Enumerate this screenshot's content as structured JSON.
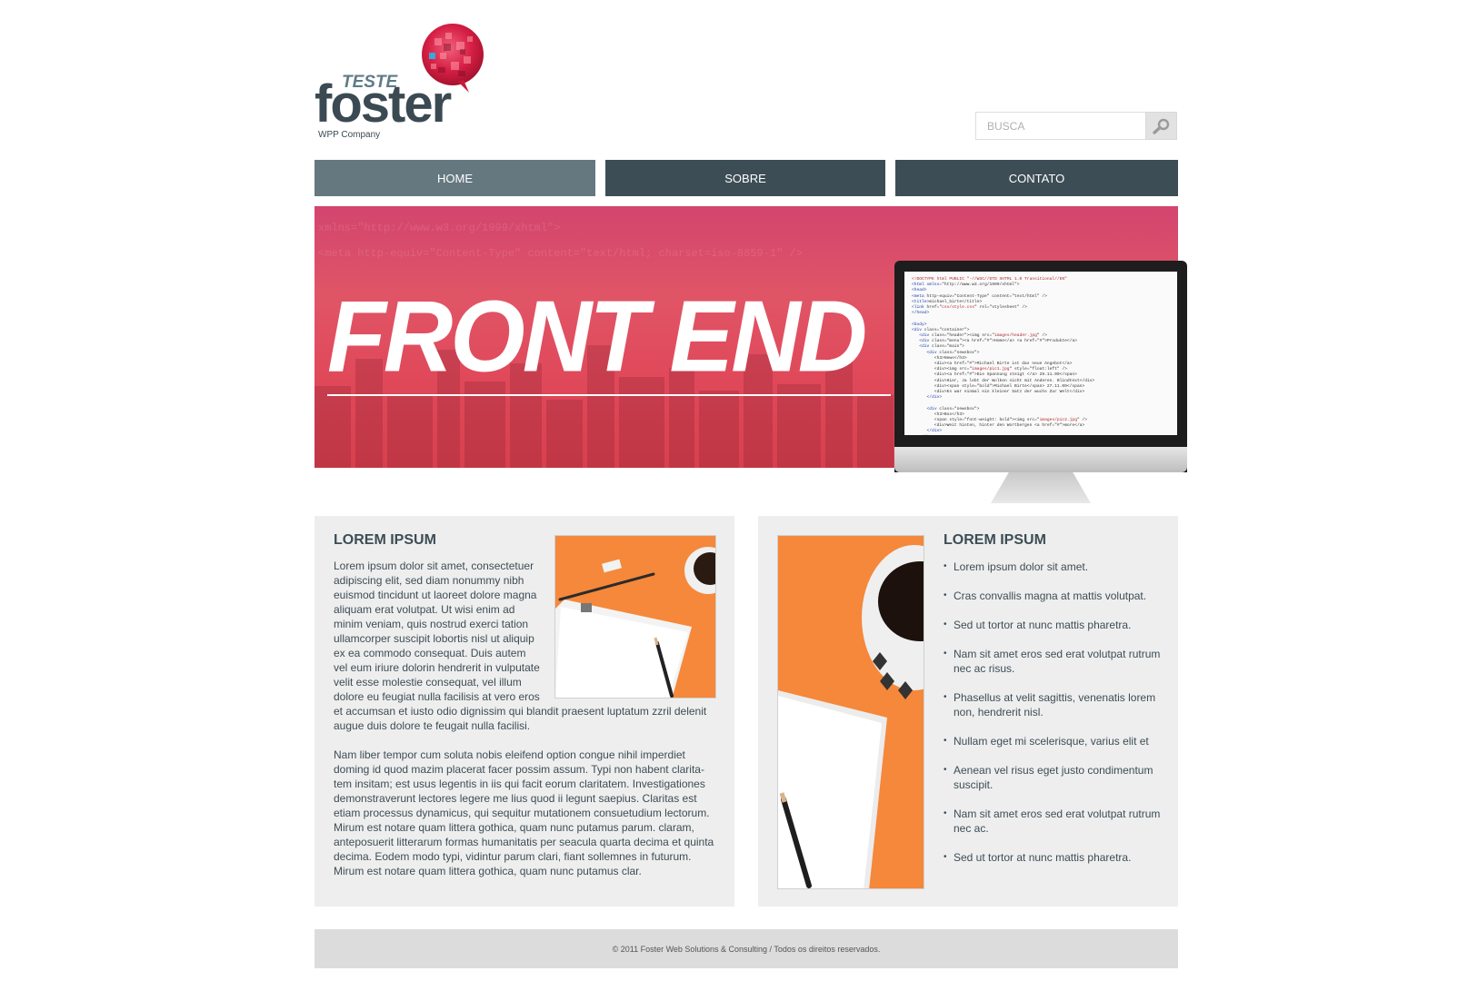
{
  "logo": {
    "teste": "TESTE",
    "name": "foster",
    "tagline": "WPP Company"
  },
  "search": {
    "placeholder": "BUSCA",
    "icon": "search-icon"
  },
  "nav": {
    "items": [
      {
        "label": "HOME"
      },
      {
        "label": "SOBRE"
      },
      {
        "label": "CONTATO"
      }
    ]
  },
  "banner": {
    "title": "FRONT END",
    "code_bg": "xmlns=\"http://www.w3.org/1999/xhtml\">\n<meta http-equiv=\"Content-Type\" content=\"text/html; charset=iso-8859-1\" />"
  },
  "left_box": {
    "title": "LOREM IPSUM",
    "paragraph1": "Lorem ipsum dolor sit amet, consectetuer adipiscing elit, sed diam nonummy nibh euismod tincidunt ut laoreet dolore magna aliquam erat volutpat. Ut wisi enim ad minim veniam, quis nostrud exerci tation ullamcorper suscipit lobortis nisl ut aliquip ex ea commodo consequat. Duis autem vel eum iriure dolorin hendrerit in vulputate velit esse molestie consequat, vel illum dolore eu feugiat nulla facilisis at vero eros et accumsan et iusto odio dignissim qui blandit praesent luptatum zzril delenit augue duis dolore te feugait nulla facilisi.",
    "paragraph2": "Nam liber tempor cum soluta nobis eleifend option congue nihil imperdiet doming id quod mazim placerat facer possim assum. Typi non habent clarita- tem insitam; est usus legentis in iis qui facit eorum claritatem. Investigationes demonstraverunt lectores legere me lius quod ii legunt saepius. Claritas est etiam processus dynamicus, qui sequitur mutationem consuetudium lectorum. Mirum est notare quam littera gothica, quam nunc putamus parum. claram, anteposuerit litterarum formas humanitatis per seacula quarta decima et quinta decima. Eodem modo typi, vidintur parum clari, fiant sollemnes in futurum. Mirum est notare quam littera gothica, quam nunc putamus clar."
  },
  "right_box": {
    "title": "LOREM IPSUM",
    "items": [
      "Lorem ipsum dolor sit amet.",
      "Cras convallis magna at mattis volutpat.",
      "Sed ut tortor at nunc mattis pharetra.",
      "Nam sit amet eros sed erat volutpat rutrum nec ac risus.",
      "Phasellus at velit sagittis, venenatis lorem non, hendrerit nisl.",
      "Nullam eget mi scelerisque, varius elit et",
      "Aenean vel risus eget justo condimentum suscipit.",
      "Nam sit amet eros sed erat volutpat rutrum nec ac.",
      "Sed ut tortor at nunc mattis pharetra."
    ]
  },
  "footer": {
    "text": "© 2011 Foster Web Solutions & Consulting / Todos os direitos reservados."
  },
  "colors": {
    "nav_active": "#657880",
    "nav": "#3d4d55",
    "banner": "#e0495a",
    "accent_orange": "#f5883a",
    "box_bg": "#eeeeee",
    "footer_bg": "#dcdcdc"
  }
}
